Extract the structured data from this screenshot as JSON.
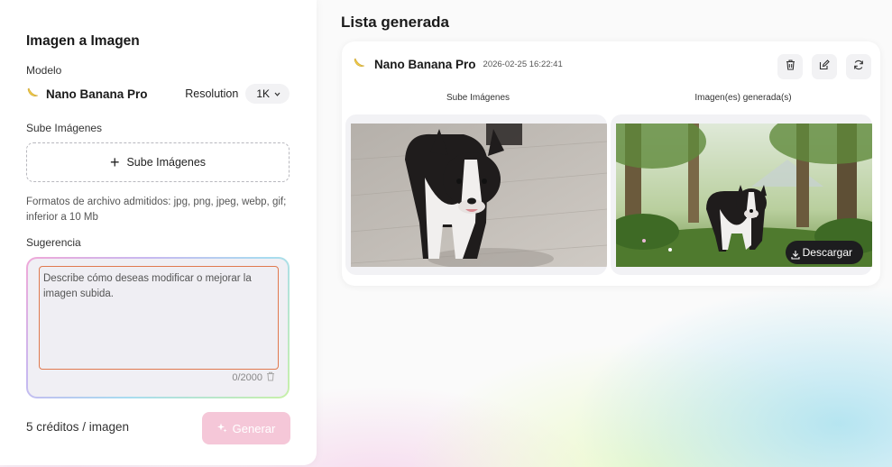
{
  "left": {
    "title": "Imagen a Imagen",
    "model_label": "Modelo",
    "model_name": "Nano Banana Pro",
    "resolution_label": "Resolution",
    "resolution_value": "1K",
    "upload_label": "Sube Imágenes",
    "upload_button": "Sube Imágenes",
    "formats_text": "Formatos de archivo admitidos: jpg, png, jpeg, webp, gif; inferior a 10 Mb",
    "prompt_label": "Sugerencia",
    "prompt_placeholder": "Describe cómo deseas modificar o mejorar la imagen subida.",
    "prompt_value": "",
    "counter": "0/2000",
    "credits": "5 créditos / imagen",
    "generate_button": "Generar"
  },
  "right": {
    "title": "Lista generada",
    "card": {
      "model_name": "Nano Banana Pro",
      "timestamp": "2026-02-25 16:22:41",
      "col_uploaded": "Sube Imágenes",
      "col_generated": "Imagen(es) generada(s)",
      "download_button": "Descargar"
    }
  },
  "icons": {
    "model": "banana-icon",
    "delete": "trash-icon",
    "edit": "edit-icon",
    "regenerate": "refresh-icon",
    "download": "download-icon"
  },
  "colors": {
    "prompt_border": "#e07a4f",
    "generate_button": "#f5c7d8",
    "download_button": "#1d1d1f"
  }
}
